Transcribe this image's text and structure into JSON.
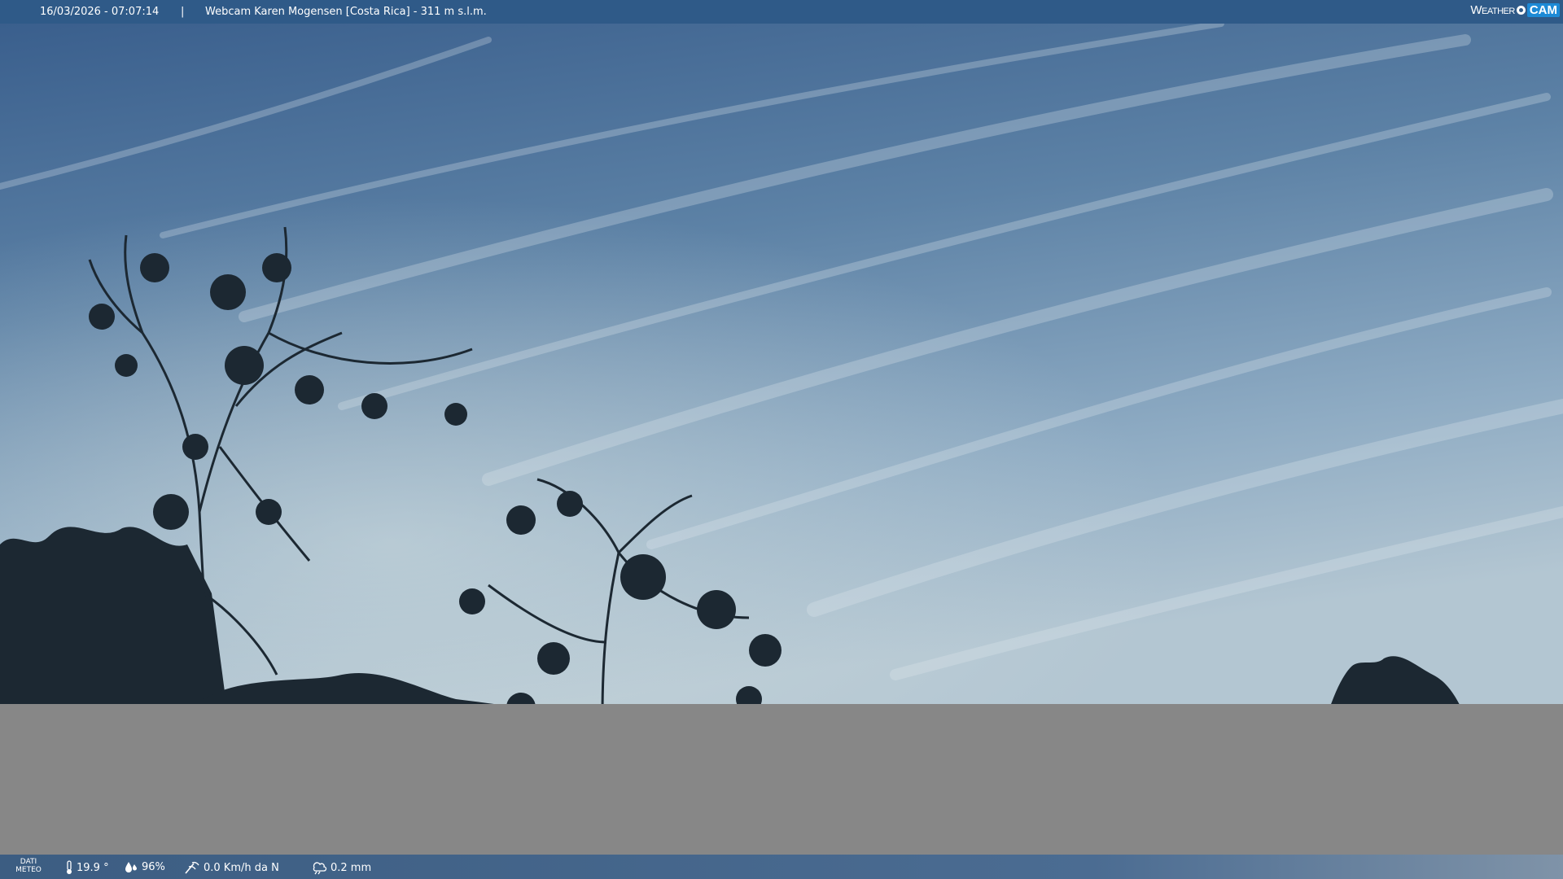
{
  "header": {
    "timestamp": "16/03/2026 - 07:07:14",
    "separator": "|",
    "title": "Webcam Karen Mogensen [Costa Rica]  - 311 m s.l.m.",
    "logo_left": "Weather",
    "logo_right": "CAM"
  },
  "weather": {
    "label_line1": "DATI",
    "label_line2": "METEO",
    "temperature": "19.9 °",
    "humidity": "96%",
    "wind": "0.0 Km/h da N",
    "rain": "0.2 mm"
  },
  "icons": {
    "temperature": "thermometer-icon",
    "humidity": "humidity-drop-icon",
    "wind": "wind-icon",
    "rain": "rain-cloud-icon",
    "logo": "weathercam-logo-icon"
  },
  "colors": {
    "header_bar": "#2f5a88",
    "sky_top": "#3d6290",
    "sky_bottom": "#a9c0cf",
    "grey_area": "#878787",
    "foliage": "#1a2630"
  }
}
